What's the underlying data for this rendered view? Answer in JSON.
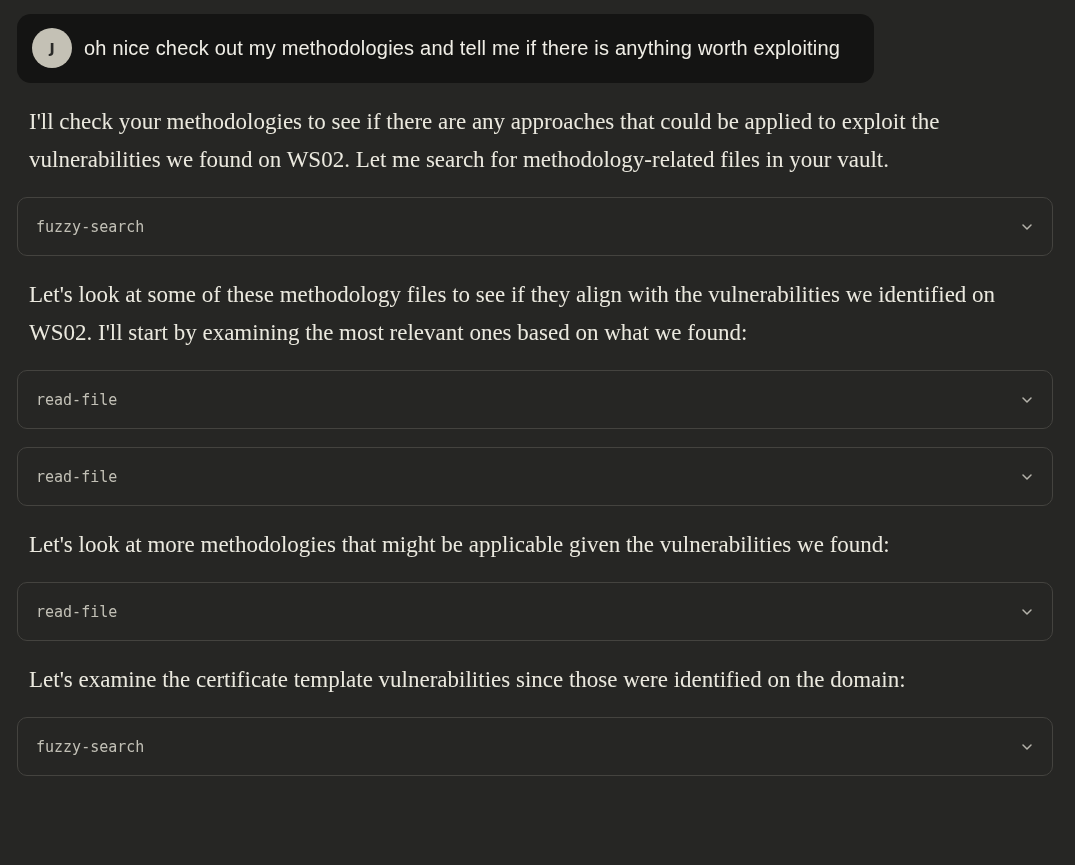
{
  "user_message": {
    "avatar": "J",
    "text": "oh nice check out my methodologies and tell me if there is anything worth exploiting"
  },
  "items": [
    {
      "kind": "text",
      "text": "I'll check your methodologies to see if there are any approaches that could be applied to exploit the vulnerabilities we found on WS02. Let me search for methodology-related files in your vault."
    },
    {
      "kind": "tool",
      "label": "fuzzy-search",
      "expanded": false
    },
    {
      "kind": "text",
      "text": "Let's look at some of these methodology files to see if they align with the vulnerabilities we identified on WS02. I'll start by examining the most relevant ones based on what we found:"
    },
    {
      "kind": "tool",
      "label": "read-file",
      "expanded": false
    },
    {
      "kind": "tool",
      "label": "read-file",
      "expanded": false
    },
    {
      "kind": "text",
      "text": "Let's look at more methodologies that might be applicable given the vulnerabilities we found:"
    },
    {
      "kind": "tool",
      "label": "read-file",
      "expanded": false
    },
    {
      "kind": "text",
      "text": "Let's examine the certificate template vulnerabilities since those were identified on the domain:"
    },
    {
      "kind": "tool",
      "label": "fuzzy-search",
      "expanded": false
    }
  ]
}
